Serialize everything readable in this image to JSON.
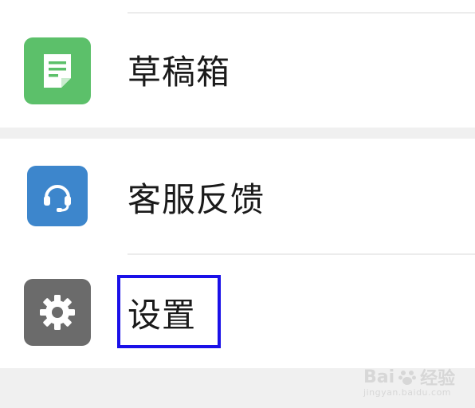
{
  "menu": {
    "drafts": {
      "label": "草稿箱",
      "icon": "document-icon",
      "color": "#5cc06a"
    },
    "support": {
      "label": "客服反馈",
      "icon": "headset-icon",
      "color": "#3d86cc"
    },
    "settings": {
      "label": "设置",
      "icon": "gear-icon",
      "color": "#6b6b6b"
    }
  },
  "watermark": {
    "brand": "Bai",
    "brand_suffix": "经验",
    "url": "jingyan.baidu.com"
  }
}
